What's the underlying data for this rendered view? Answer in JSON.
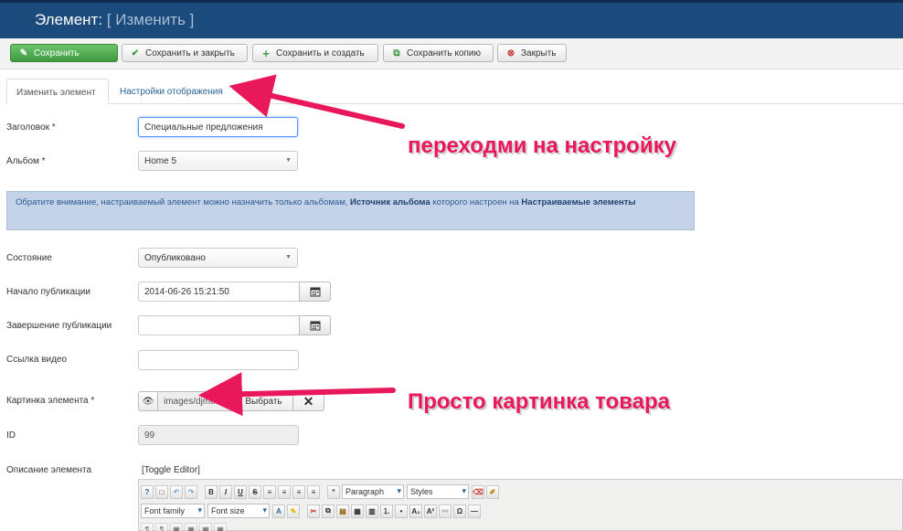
{
  "header": {
    "title": "Элемент:",
    "subtitle": "[ Изменить ]"
  },
  "toolbar": {
    "save": "Сохранить",
    "save_close": "Сохранить и закрыть",
    "save_new": "Сохранить и создать",
    "save_copy": "Сохранить копию",
    "close": "Закрыть"
  },
  "tabs": {
    "edit": "Изменить элемент",
    "display": "Настройки отображения"
  },
  "form": {
    "title_label": "Заголовок *",
    "title_value": "Специальные предложения",
    "album_label": "Альбом *",
    "album_value": "Home 5",
    "notice_a": "Обратите внимание, настраиваемый элемент можно назначить только альбомам, ",
    "notice_b": "Источник альбома",
    "notice_c": " которого настроен на ",
    "notice_d": "Настраиваемые элементы",
    "state_label": "Состояние",
    "state_value": "Опубликовано",
    "pub_start_label": "Начало публикации",
    "pub_start_value": "2014-06-26 15:21:50",
    "pub_end_label": "Завершение публикации",
    "pub_end_value": "",
    "video_label": "Ссылка видео",
    "video_value": "",
    "image_label": "Картинка элемента *",
    "image_path": "images/djmedia",
    "image_pick": "Выбрать",
    "id_label": "ID",
    "id_value": "99",
    "desc_label": "Описание элемента",
    "toggle_editor": "[Toggle Editor]"
  },
  "editor": {
    "paragraph": "Paragraph",
    "styles": "Styles",
    "font_family": "Font family",
    "font_size": "Font size"
  },
  "annotations": {
    "settings": "переходми на настройку",
    "picture": "Просто картинка товара"
  },
  "colors": {
    "header_bg": "#1b4a7c",
    "save_green": "#3f9a3f",
    "annotation": "#e8185a"
  }
}
